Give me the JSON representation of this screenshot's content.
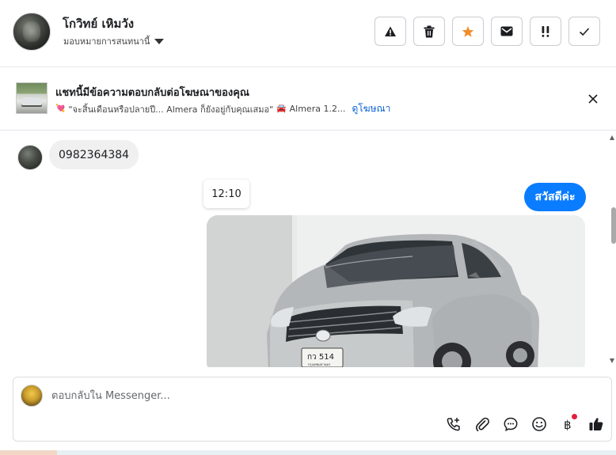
{
  "header": {
    "contact_name": "โกวิทย์ เหิมวัง",
    "assign_label": "มอบหมายการสนทนานี้",
    "actions": [
      {
        "name": "report-spam-button",
        "icon": "warning-icon"
      },
      {
        "name": "delete-button",
        "icon": "trash-icon"
      },
      {
        "name": "star-button",
        "icon": "star-icon",
        "color": "#f28c28"
      },
      {
        "name": "mark-unread-button",
        "icon": "envelope-icon"
      },
      {
        "name": "follow-up-button",
        "icon": "exclamation-icon"
      },
      {
        "name": "mark-done-button",
        "icon": "check-icon"
      }
    ]
  },
  "ad_banner": {
    "title": "แชทนี้มีข้อความตอบกลับต่อโฆษณาของคุณ",
    "quote": "\"จะสิ้นเดือนหรือปลายปี... Almera ก็ยังอยู่กับคุณเสมอ\"",
    "car_text": "Almera 1.2...",
    "link": "ดูโฆษณา",
    "emoji": "💘",
    "car_emoji": "🚘"
  },
  "conversation": {
    "incoming_message": "0982364384",
    "timestamp": "12:10",
    "outgoing_message": "สวัสดีค่ะ",
    "image": {
      "plate_line1": "กว 514",
      "plate_line2": "กรุงเทพมหานคร"
    }
  },
  "composer": {
    "placeholder": "ตอบกลับใน Messenger...",
    "tools": [
      "call-icon",
      "attachment-icon",
      "chat-bubble-icon",
      "emoji-icon",
      "baht-icon",
      "thumbs-up-icon"
    ]
  },
  "colors": {
    "accent": "#0a7cff",
    "link": "#0a62d4",
    "star": "#f28c28",
    "notification": "#e41e3f"
  }
}
